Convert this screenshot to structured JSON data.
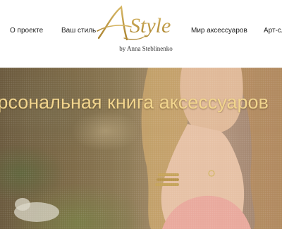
{
  "nav": {
    "left": [
      "О проекте",
      "Ваш стиль"
    ],
    "right": [
      "Мир аксессуаров",
      "Арт-сл"
    ]
  },
  "logo": {
    "main": "AStyle",
    "subtitle": "by Anna Steblinenko"
  },
  "hero": {
    "title": "Персональная книга аксессуаров"
  },
  "colors": {
    "gold": "#c9a24a",
    "hero_text": "#f2d58e"
  }
}
